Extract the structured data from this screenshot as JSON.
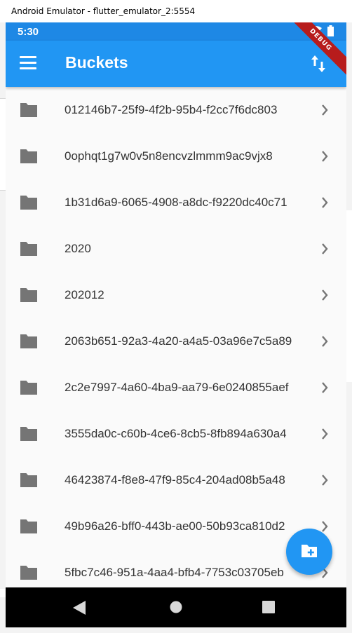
{
  "window": {
    "title": "Android Emulator - flutter_emulator_2:5554"
  },
  "status_bar": {
    "time": "5:30"
  },
  "app_bar": {
    "title": "Buckets"
  },
  "debug_banner": "DEBUG",
  "buckets": [
    {
      "label": "012146b7-25f9-4f2b-95b4-f2cc7f6dc803"
    },
    {
      "label": "0ophqt1g7w0v5n8encvzlmmm9ac9vjx8"
    },
    {
      "label": "1b31d6a9-6065-4908-a8dc-f9220dc40c71"
    },
    {
      "label": "2020"
    },
    {
      "label": "202012"
    },
    {
      "label": "2063b651-92a3-4a20-a4a5-03a96e7c5a89"
    },
    {
      "label": "2c2e7997-4a60-4ba9-aa79-6e0240855aef"
    },
    {
      "label": "3555da0c-c60b-4ce6-8cb5-8fb894a630a4"
    },
    {
      "label": "46423874-f8e8-47f9-85c4-204ad08b5a48"
    },
    {
      "label": "49b96a26-bff0-443b-ae00-50b93ca810d2"
    },
    {
      "label": "5fbc7c46-951a-4aa4-bfb4-7753c03705eb"
    }
  ],
  "colors": {
    "primary": "#2196f3",
    "status_bar": "#1e88e5",
    "folder_icon": "#757575",
    "chevron": "#757575",
    "debug": "#b71c1c"
  },
  "icons": {
    "menu": "menu-icon",
    "sort": "swap-vert-icon",
    "folder": "folder-icon",
    "chevron": "chevron-right-icon",
    "fab": "create-new-folder-icon"
  }
}
